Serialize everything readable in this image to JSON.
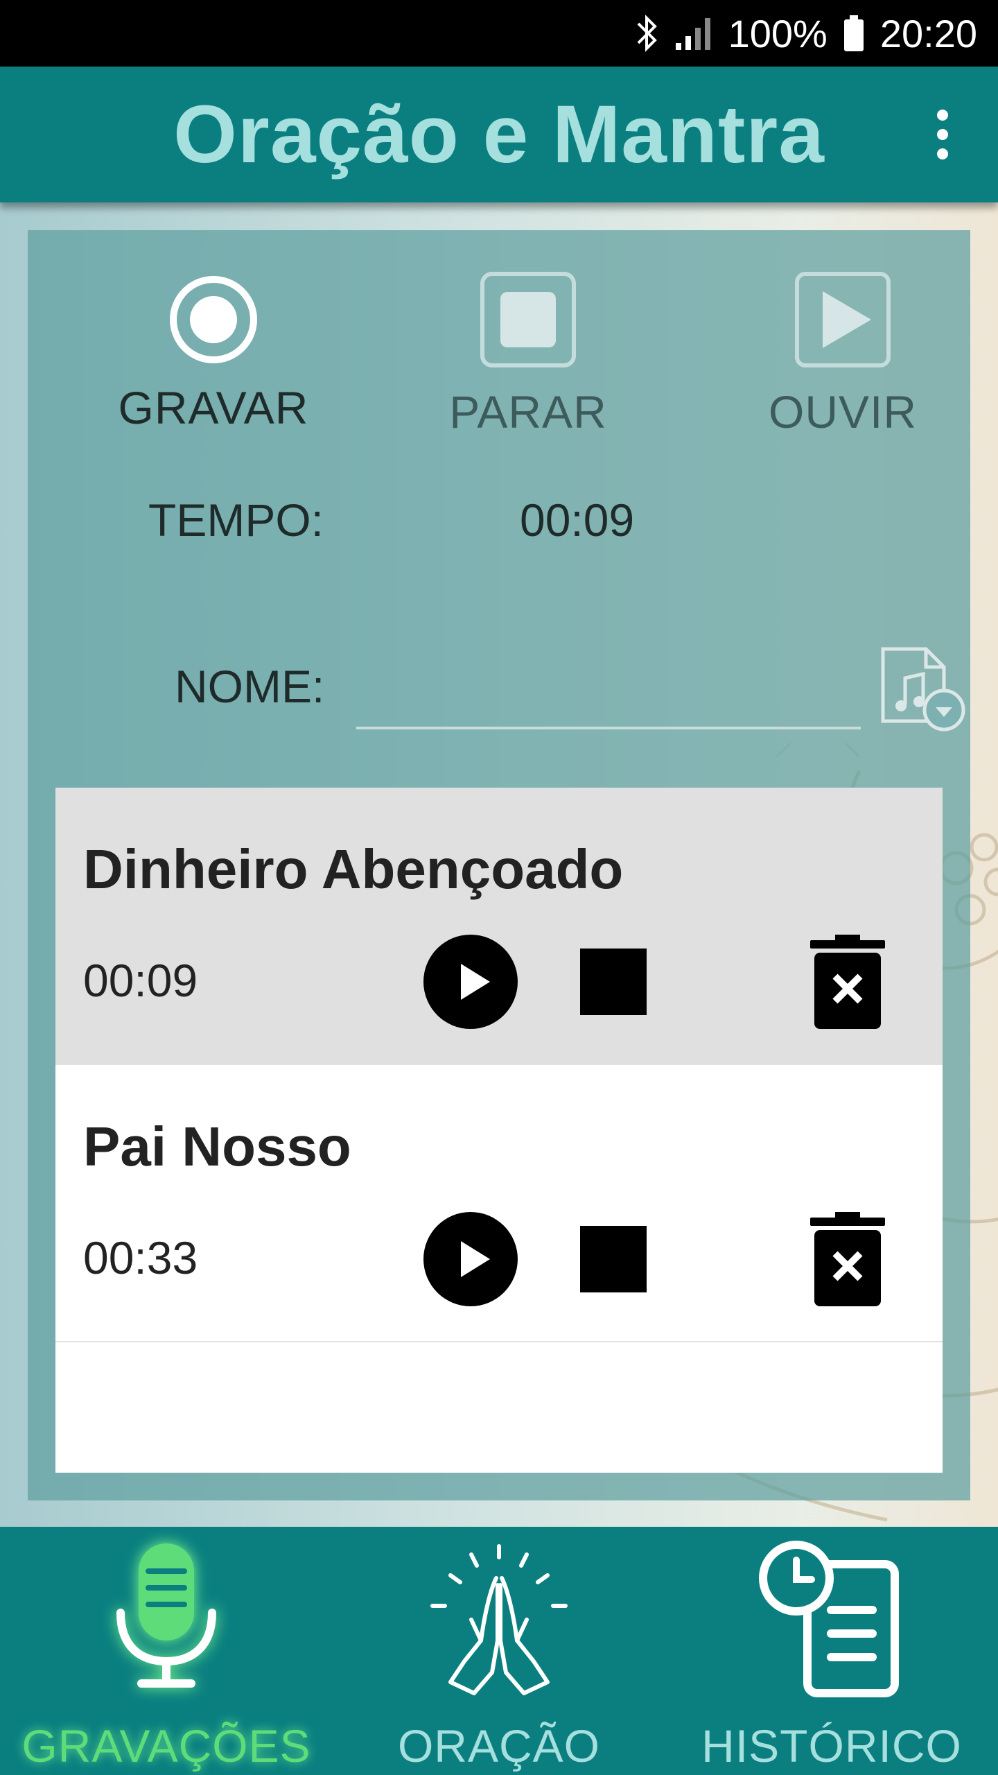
{
  "status_bar": {
    "battery": "100%",
    "time": "20:20",
    "icons": [
      "bluetooth-icon",
      "signal-icon",
      "battery-icon"
    ]
  },
  "app_bar": {
    "title": "Oração e Mantra",
    "menu_icon": "more-vert-icon"
  },
  "recorder": {
    "record_label": "GRAVAR",
    "stop_label": "PARAR",
    "play_label": "OUVIR",
    "time_label": "TEMPO:",
    "time_value": "00:09",
    "name_label": "NOME:",
    "name_value": "",
    "name_placeholder": "",
    "file_icon": "music-file-icon"
  },
  "recordings": [
    {
      "title": "Dinheiro Abençoado",
      "duration": "00:09",
      "selected": true
    },
    {
      "title": "Pai Nosso",
      "duration": "00:33",
      "selected": false
    }
  ],
  "bottom_nav": {
    "items": [
      {
        "label": "GRAVAÇÕES",
        "icon": "microphone-icon",
        "active": true
      },
      {
        "label": "ORAÇÃO",
        "icon": "praying-hands-icon",
        "active": false
      },
      {
        "label": "HISTÓRICO",
        "icon": "history-document-icon",
        "active": false
      }
    ]
  },
  "colors": {
    "primary": "#0b7f80",
    "title_text": "#a6e0de",
    "active_nav": "#5fdc7a",
    "panel": "#60a0a0"
  }
}
